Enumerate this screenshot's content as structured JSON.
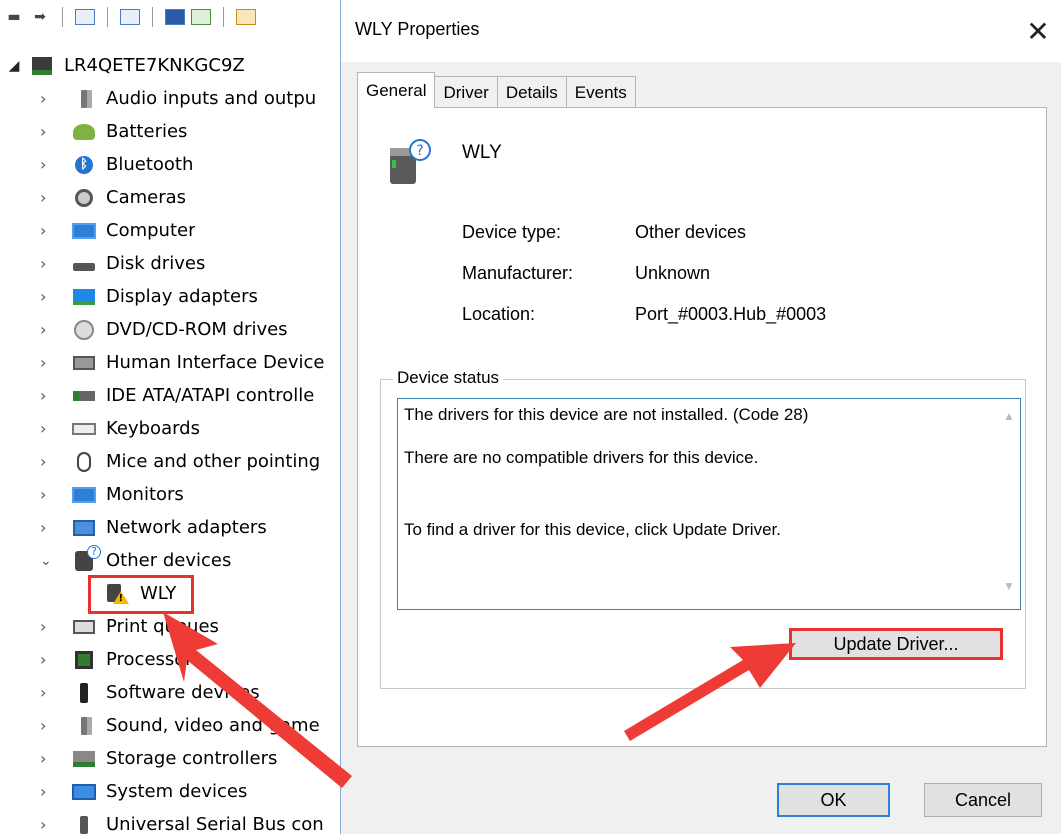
{
  "device_manager": {
    "root_label": "LR4QETE7KNKGC9Z",
    "categories": [
      {
        "label": "Audio inputs and outpu",
        "icon": "speaker-icon"
      },
      {
        "label": "Batteries",
        "icon": "battery-icon"
      },
      {
        "label": "Bluetooth",
        "icon": "bluetooth-icon"
      },
      {
        "label": "Cameras",
        "icon": "camera-icon"
      },
      {
        "label": "Computer",
        "icon": "monitor-icon"
      },
      {
        "label": "Disk drives",
        "icon": "disk-drive-icon"
      },
      {
        "label": "Display adapters",
        "icon": "display-adapter-icon"
      },
      {
        "label": "DVD/CD-ROM drives",
        "icon": "dvd-icon"
      },
      {
        "label": "Human Interface Device",
        "icon": "hid-icon"
      },
      {
        "label": "IDE ATA/ATAPI controlle",
        "icon": "ide-controller-icon"
      },
      {
        "label": "Keyboards",
        "icon": "keyboard-icon"
      },
      {
        "label": "Mice and other pointing",
        "icon": "mouse-icon"
      },
      {
        "label": "Monitors",
        "icon": "monitor-icon"
      },
      {
        "label": "Network adapters",
        "icon": "network-adapter-icon"
      },
      {
        "label": "Other devices",
        "icon": "unknown-device-icon",
        "expanded": true
      },
      {
        "label": "Print queues",
        "icon": "printer-icon"
      },
      {
        "label": "Processors",
        "icon": "processor-icon"
      },
      {
        "label": "Software devices",
        "icon": "software-device-icon"
      },
      {
        "label": "Sound, video and game",
        "icon": "speaker-icon"
      },
      {
        "label": "Storage controllers",
        "icon": "storage-controller-icon"
      },
      {
        "label": "System devices",
        "icon": "system-devices-icon"
      },
      {
        "label": "Universal Serial Bus con",
        "icon": "usb-icon"
      }
    ],
    "other_devices_child": {
      "label": "WLY",
      "icon": "warning-device-icon"
    }
  },
  "dialog": {
    "title": "WLY Properties",
    "close_glyph": "✕",
    "tabs": [
      {
        "label": "General",
        "active": true
      },
      {
        "label": "Driver",
        "active": false
      },
      {
        "label": "Details",
        "active": false
      },
      {
        "label": "Events",
        "active": false
      }
    ],
    "device_name": "WLY",
    "properties": {
      "device_type_label": "Device type:",
      "device_type_value": "Other devices",
      "manufacturer_label": "Manufacturer:",
      "manufacturer_value": "Unknown",
      "location_label": "Location:",
      "location_value": "Port_#0003.Hub_#0003"
    },
    "device_status_label": "Device status",
    "status_lines": [
      "The drivers for this device are not installed. (Code 28)",
      "There are no compatible drivers for this device.",
      "To find a driver for this device, click Update Driver."
    ],
    "update_driver_label": "Update Driver...",
    "ok_label": "OK",
    "cancel_label": "Cancel"
  },
  "colors": {
    "highlight_red": "#e8302e",
    "dialog_bg": "#f0f0f0",
    "focus_blue": "#2d7fd4"
  }
}
